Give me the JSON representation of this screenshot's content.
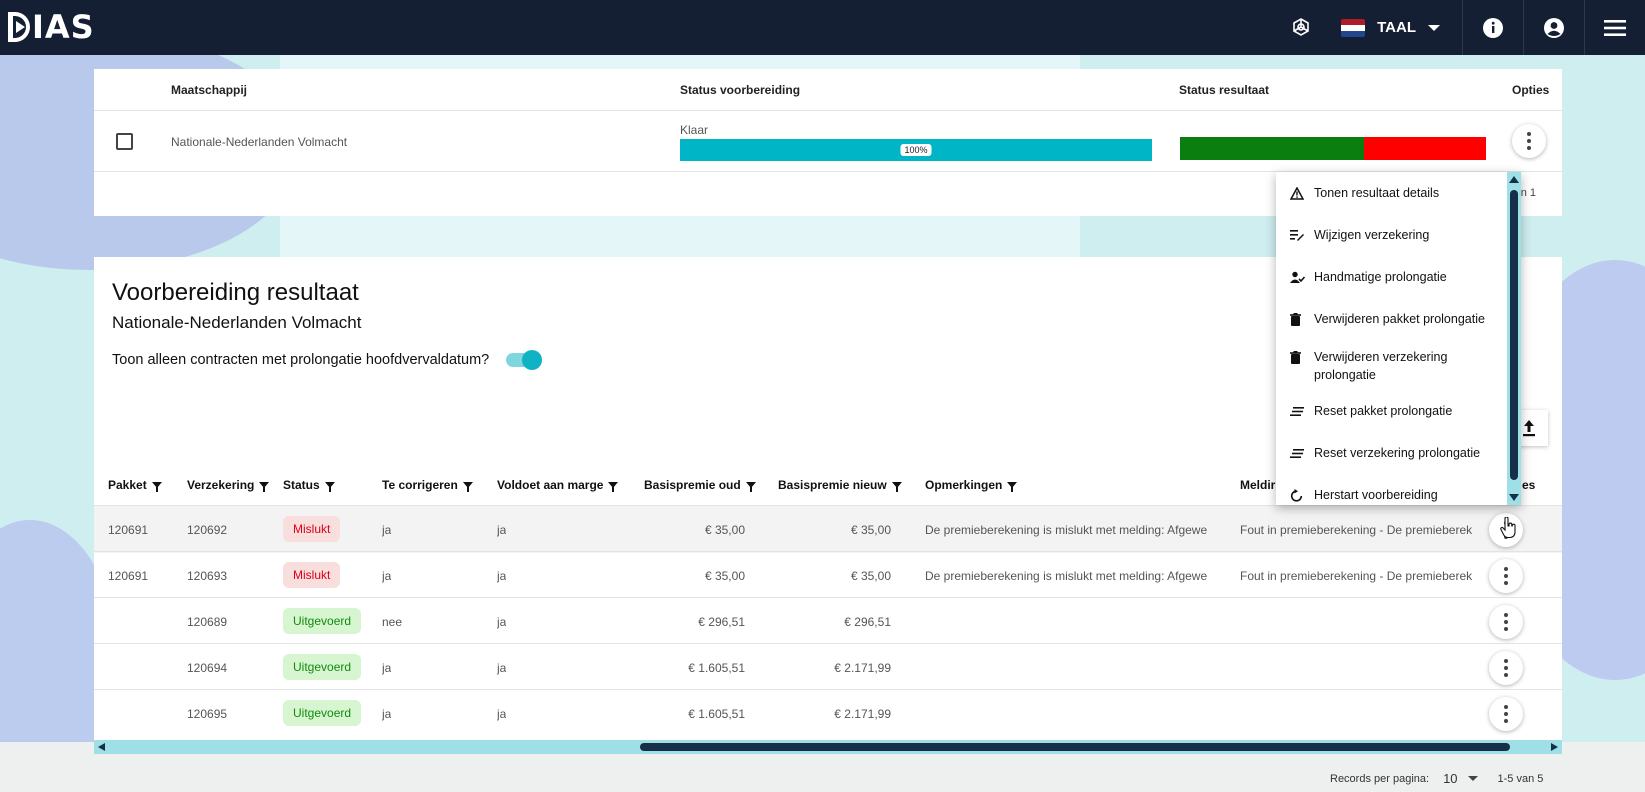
{
  "header": {
    "logo_text": "IAS",
    "language_label": "TAAL",
    "icons": [
      "openai-icon",
      "flag-nl-icon",
      "info-icon",
      "account-icon",
      "menu-icon"
    ],
    "flag_colors": [
      "#ae1c28",
      "#ffffff",
      "#21468b"
    ]
  },
  "top_table": {
    "columns": {
      "company": "Maatschappij",
      "prep_status": "Status voorbereiding",
      "result_status": "Status resultaat",
      "options": "Opties"
    },
    "row": {
      "company": "Nationale-Nederlanden Volmacht",
      "prep_state": "Klaar",
      "progress_label": "100%",
      "progress": 1.0,
      "result_success_fraction": 0.6
    },
    "pagination_partial": "n 1"
  },
  "options_menu": {
    "items": [
      {
        "label": "Tonen resultaat details",
        "icon": "warning-icon"
      },
      {
        "label": "Wijzigen verzekering",
        "icon": "edit-list-icon"
      },
      {
        "label": "Handmatige prolongatie",
        "icon": "person-check-icon"
      },
      {
        "label": "Verwijderen pakket prolongatie",
        "icon": "trash-icon"
      },
      {
        "label": "Verwijderen verzekering prolongatie",
        "icon": "trash-icon"
      },
      {
        "label": "Reset pakket prolongatie",
        "icon": "reset-list-icon"
      },
      {
        "label": "Reset verzekering prolongatie",
        "icon": "reset-list-icon"
      },
      {
        "label": "Herstart voorbereiding",
        "icon": "restart-icon"
      }
    ]
  },
  "result_panel": {
    "title": "Voorbereiding resultaat",
    "subtitle": "Nationale-Nederlanden Volmacht",
    "toggle_label": "Toon alleen contracten met prolongatie hoofdvervaldatum?",
    "toggle_on": true
  },
  "result_table": {
    "columns": {
      "pakket": "Pakket",
      "verzekering": "Verzekering",
      "status": "Status",
      "te_corrigeren": "Te corrigeren",
      "voldoet": "Voldoet aan marge",
      "oud": "Basispremie oud",
      "nieuw": "Basispremie nieuw",
      "opmerkingen": "Opmerkingen",
      "melding": "Meldir",
      "opties": "es"
    },
    "rows": [
      {
        "pakket": "120691",
        "verzekering": "120692",
        "status": "Mislukt",
        "te_corrigeren": "ja",
        "voldoet": "ja",
        "oud": "€ 35,00",
        "nieuw": "€ 35,00",
        "opmerkingen": "De premieberekening is mislukt met melding: Afgewe",
        "melding": "Fout in premieberekening - De premieberek"
      },
      {
        "pakket": "120691",
        "verzekering": "120693",
        "status": "Mislukt",
        "te_corrigeren": "ja",
        "voldoet": "ja",
        "oud": "€ 35,00",
        "nieuw": "€ 35,00",
        "opmerkingen": "De premieberekening is mislukt met melding: Afgewe",
        "melding": "Fout in premieberekening - De premieberek"
      },
      {
        "pakket": "",
        "verzekering": "120689",
        "status": "Uitgevoerd",
        "te_corrigeren": "nee",
        "voldoet": "ja",
        "oud": "€ 296,51",
        "nieuw": "€ 296,51",
        "opmerkingen": "",
        "melding": ""
      },
      {
        "pakket": "",
        "verzekering": "120694",
        "status": "Uitgevoerd",
        "te_corrigeren": "ja",
        "voldoet": "ja",
        "oud": "€ 1.605,51",
        "nieuw": "€ 2.171,99",
        "opmerkingen": "",
        "melding": ""
      },
      {
        "pakket": "",
        "verzekering": "120695",
        "status": "Uitgevoerd",
        "te_corrigeren": "ja",
        "voldoet": "ja",
        "oud": "€ 1.605,51",
        "nieuw": "€ 2.171,99",
        "opmerkingen": "",
        "melding": ""
      }
    ]
  },
  "pagination": {
    "records_label": "Records per pagina:",
    "per_page": "10",
    "range": "1-5 van 5"
  },
  "colors": {
    "topbar": "#141f33",
    "progress": "#00b5c6",
    "result_success": "#0a7f10",
    "result_fail": "#ff0000",
    "chip_fail_text": "#d8001a",
    "chip_ok_text": "#118c0b"
  }
}
